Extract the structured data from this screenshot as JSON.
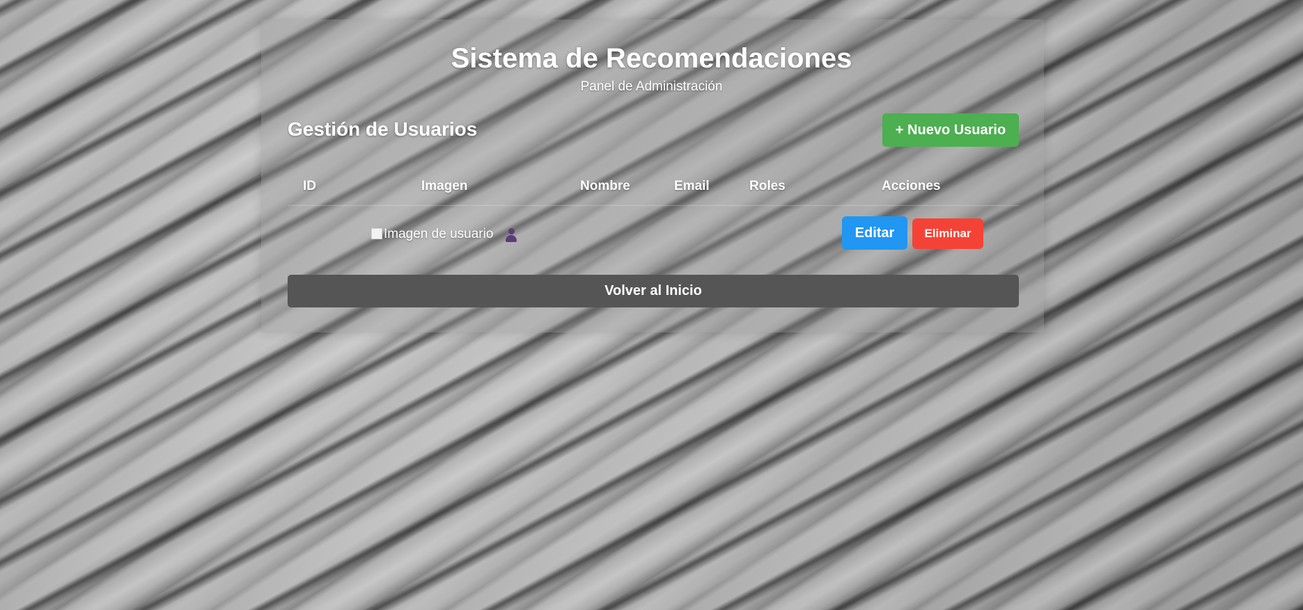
{
  "header": {
    "title": "Sistema de Recomendaciones",
    "subtitle": "Panel de Administración"
  },
  "section": {
    "title": "Gestión de Usuarios",
    "new_user_label": "+ Nuevo Usuario"
  },
  "table": {
    "columns": {
      "id": "ID",
      "imagen": "Imagen",
      "nombre": "Nombre",
      "email": "Email",
      "roles": "Roles",
      "acciones": "Acciones"
    },
    "rows": [
      {
        "image_alt": "Imagen de usuario",
        "avatar_icon": "user-icon",
        "edit_label": "Editar",
        "delete_label": "Eliminar"
      }
    ]
  },
  "footer": {
    "back_label": "Volver al Inicio"
  },
  "colors": {
    "new_user_button": "#4caf50",
    "edit_button": "#2196f3",
    "delete_button": "#f44336",
    "back_button": "#555555"
  }
}
